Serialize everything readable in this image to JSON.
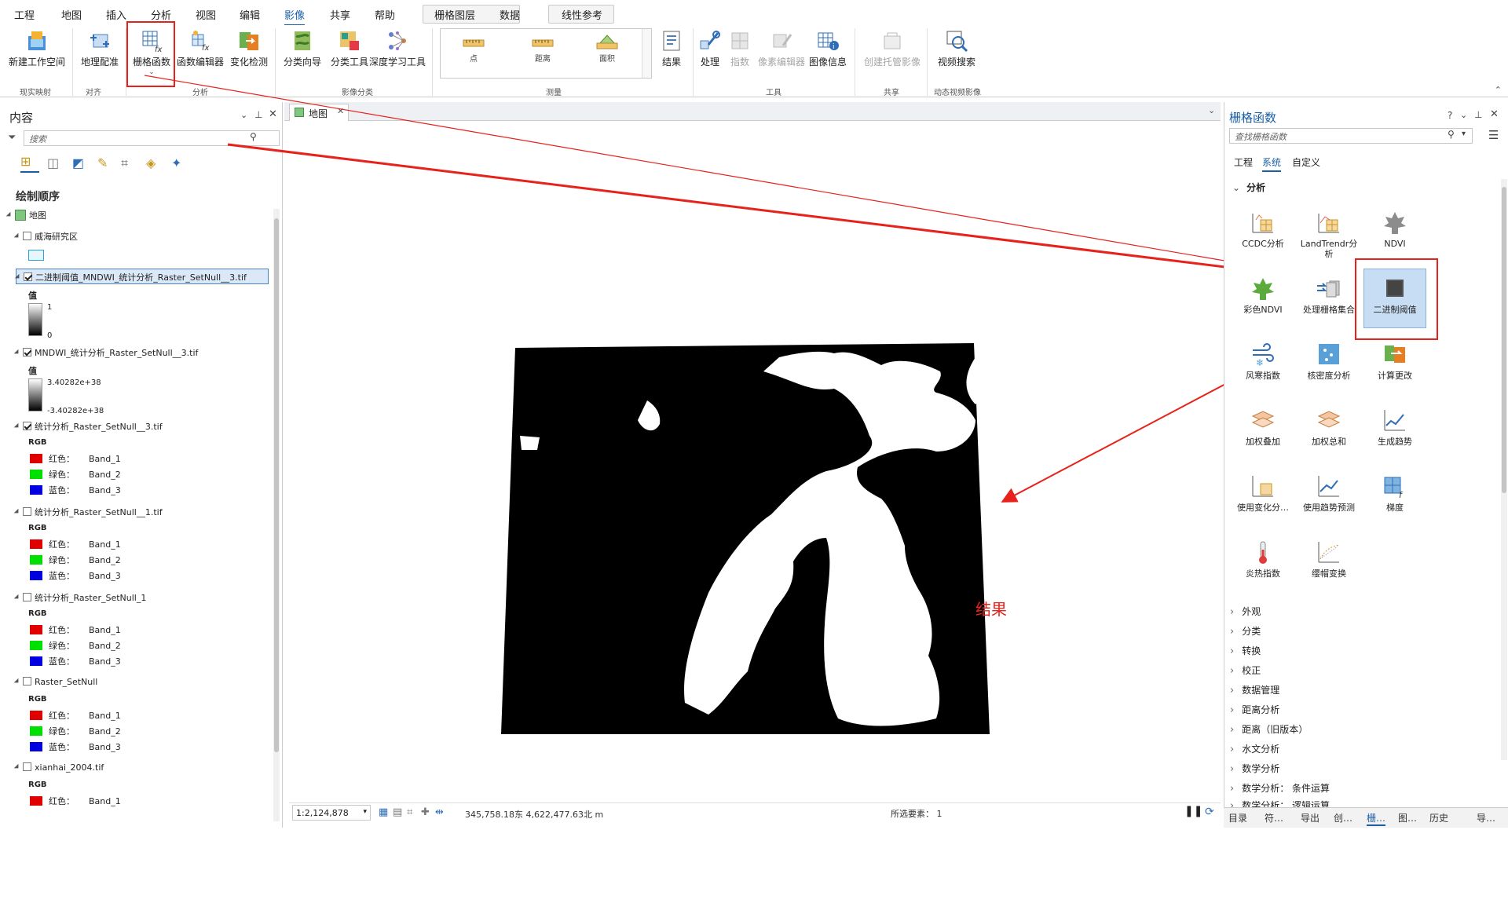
{
  "tabs": [
    "工程",
    "地图",
    "插入",
    "分析",
    "视图",
    "编辑",
    "影像",
    "共享",
    "帮助"
  ],
  "context_tabs": {
    "label1": "栅格图层",
    "label2": "数据",
    "label3": "线性参考"
  },
  "ribbon": {
    "buttons": [
      "新建工作空间",
      "地理配准",
      "栅格函数",
      "函数编辑器",
      "变化检测",
      "分类向导",
      "分类工具",
      "深度学习工具",
      "结果",
      "处理",
      "指数",
      "像素编辑器",
      "图像信息",
      "创建托管影像",
      "视频搜索"
    ],
    "groups": [
      "现实映射",
      "对齐",
      "分析",
      "影像分类",
      "测量",
      "工具",
      "共享",
      "动态视频影像"
    ],
    "gallery": [
      "点",
      "距离",
      "面积"
    ]
  },
  "contents": {
    "title": "内容",
    "search_placeholder": "搜索",
    "draw_order": "绘制顺序",
    "map_label": "地图",
    "layers": [
      {
        "name": "威海研究区",
        "checked": false
      },
      {
        "name": "二进制阈值_MNDWI_统计分析_Raster_SetNull__3.tif",
        "checked": true
      },
      {
        "name": "MNDWI_统计分析_Raster_SetNull__3.tif",
        "checked": true
      },
      {
        "name": "统计分析_Raster_SetNull__3.tif",
        "checked": true
      },
      {
        "name": "统计分析_Raster_SetNull__1.tif",
        "checked": false
      },
      {
        "name": "统计分析_Raster_SetNull_1",
        "checked": false
      },
      {
        "name": "Raster_SetNull",
        "checked": false
      },
      {
        "name": "xianhai_2004.tif",
        "checked": false
      }
    ],
    "value_label": "值",
    "legend1": {
      "high": "1",
      "low": "0"
    },
    "legend2": {
      "high": "3.40282e+38",
      "low": "-3.40282e+38"
    },
    "rgb_label": "RGB",
    "bands": [
      {
        "label": "红色：",
        "band": "Band_1",
        "color": "#e00000"
      },
      {
        "label": "绿色：",
        "band": "Band_2",
        "color": "#00e000"
      },
      {
        "label": "蓝色：",
        "band": "Band_3",
        "color": "#0000e0"
      }
    ]
  },
  "map": {
    "tab_label": "地图",
    "scale": "1:2,124,878",
    "coords": "345,758.18东 4,622,477.63北 m",
    "selected": "所选要素： 1",
    "annotation": "结果"
  },
  "raster_functions": {
    "title": "栅格函数",
    "search_placeholder": "查找栅格函数",
    "subtabs": [
      "工程",
      "系统",
      "自定义"
    ],
    "section": "分析",
    "functions": [
      "CCDC分析",
      "LandTrendr分析",
      "NDVI",
      "彩色NDVI",
      "处理栅格集合",
      "二进制阈值",
      "风寒指数",
      "核密度分析",
      "计算更改",
      "加权叠加",
      "加权总和",
      "生成趋势",
      "使用变化分…",
      "使用趋势预测",
      "梯度",
      "炎热指数",
      "缨帽变换"
    ],
    "categories": [
      "外观",
      "分类",
      "转换",
      "校正",
      "数据管理",
      "距离分析",
      "距离（旧版本）",
      "水文分析",
      "数学分析",
      "数学分析： 条件运算",
      "数学分析： 逻辑运算"
    ]
  },
  "bottom_tabs": [
    "目录",
    "符…",
    "导出",
    "创…",
    "栅…",
    "图…",
    "历史",
    "导…"
  ]
}
